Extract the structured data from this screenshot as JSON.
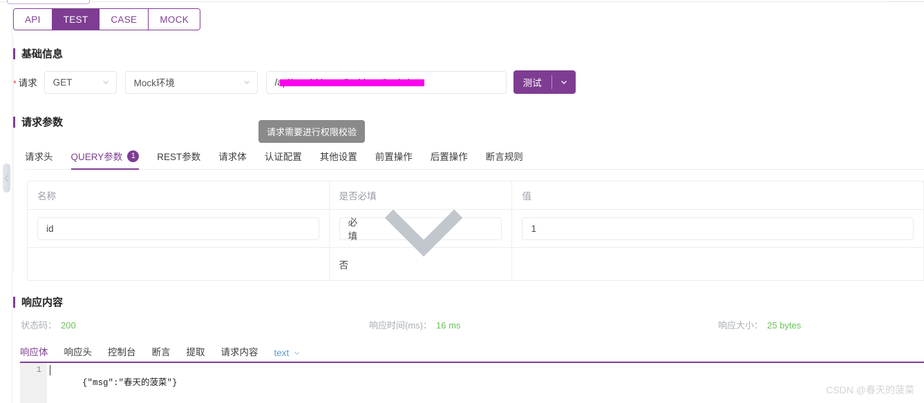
{
  "window": {
    "top_tabs": [
      {
        "id": "api",
        "label": "API",
        "active": false
      },
      {
        "id": "test",
        "label": "TEST",
        "active": true
      },
      {
        "id": "case",
        "label": "CASE",
        "active": false
      },
      {
        "id": "mock",
        "label": "MOCK",
        "active": false
      }
    ]
  },
  "basic_info": {
    "title": "基础信息",
    "request_label": "请求",
    "required_mark": "*",
    "method": "GET",
    "environment": "Mock环境",
    "url_value": "/api/mock/demo-Problem-Statistic",
    "url_redacted": true,
    "test_button": "测试"
  },
  "tooltip": {
    "text": "请求需要进行权限校验"
  },
  "request_params": {
    "title": "请求参数",
    "tabs": [
      {
        "id": "headers",
        "label": "请求头",
        "active": false,
        "badge": ""
      },
      {
        "id": "query",
        "label": "QUERY参数",
        "active": true,
        "badge": "1"
      },
      {
        "id": "rest",
        "label": "REST参数",
        "active": false,
        "badge": ""
      },
      {
        "id": "body",
        "label": "请求体",
        "active": false,
        "badge": ""
      },
      {
        "id": "auth",
        "label": "认证配置",
        "active": false,
        "badge": ""
      },
      {
        "id": "other",
        "label": "其他设置",
        "active": false,
        "badge": ""
      },
      {
        "id": "pre",
        "label": "前置操作",
        "active": false,
        "badge": ""
      },
      {
        "id": "post",
        "label": "后置操作",
        "active": false,
        "badge": ""
      },
      {
        "id": "assertion",
        "label": "断言规则",
        "active": false,
        "badge": ""
      }
    ],
    "table": {
      "columns": [
        "名称",
        "是否必填",
        "值"
      ],
      "rows": [
        {
          "name": "id",
          "required": "必填",
          "value": "1",
          "type": "input"
        },
        {
          "name": "",
          "required": "否",
          "value": "",
          "type": "text"
        }
      ]
    }
  },
  "response": {
    "title": "响应内容",
    "metrics": [
      {
        "id": "status",
        "key": "状态码：",
        "value": "200"
      },
      {
        "id": "time",
        "key": "响应时间(ms)：",
        "value": "16 ms"
      },
      {
        "id": "size",
        "key": "响应大小：",
        "value": "25 bytes"
      }
    ],
    "tabs": [
      {
        "id": "body",
        "label": "响应体",
        "active": true
      },
      {
        "id": "headers",
        "label": "响应头",
        "active": false
      },
      {
        "id": "console",
        "label": "控制台",
        "active": false
      },
      {
        "id": "assert",
        "label": "断言",
        "active": false
      },
      {
        "id": "extract",
        "label": "提取",
        "active": false
      },
      {
        "id": "request",
        "label": "请求内容",
        "active": false
      }
    ],
    "format": "text",
    "editor": {
      "line_number": "1",
      "content": "{\"msg\":\"春天的菠菜\"}"
    }
  },
  "watermark": "CSDN @春天的菠菜",
  "colors": {
    "accent": "#7e3d92",
    "success": "#6ac259",
    "redact": "#ff00ee",
    "tooltip_bg": "#8a8a8a",
    "link": "#5b9bd5"
  }
}
